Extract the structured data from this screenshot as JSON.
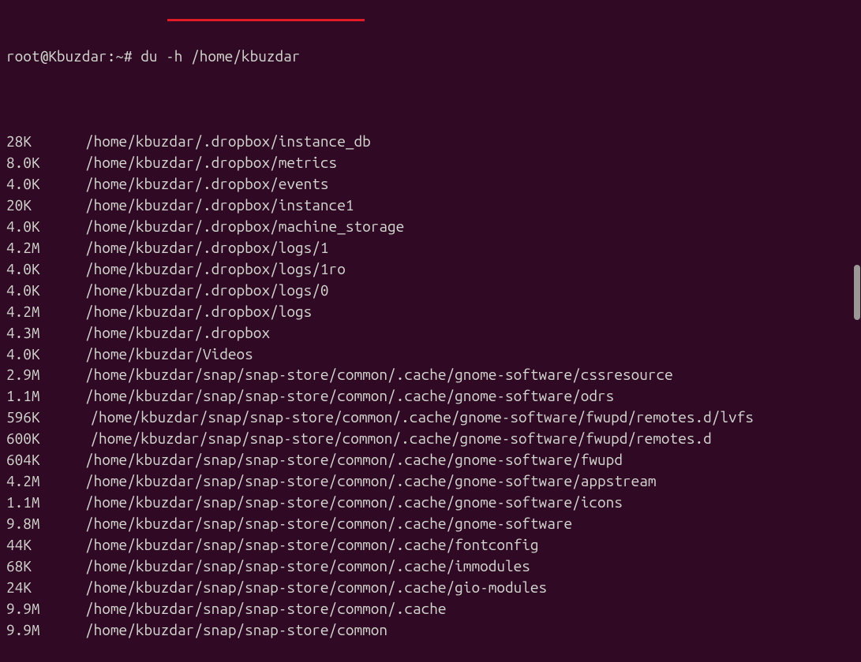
{
  "prompt": {
    "user": "root",
    "host": "Kbuzdar",
    "cwd": "~",
    "symbol": "#",
    "command": "du -h /home/kbuzdar"
  },
  "output": [
    {
      "size": "28K",
      "path": "/home/kbuzdar/.dropbox/instance_db"
    },
    {
      "size": "8.0K",
      "path": "/home/kbuzdar/.dropbox/metrics"
    },
    {
      "size": "4.0K",
      "path": "/home/kbuzdar/.dropbox/events"
    },
    {
      "size": "20K",
      "path": "/home/kbuzdar/.dropbox/instance1"
    },
    {
      "size": "4.0K",
      "path": "/home/kbuzdar/.dropbox/machine_storage"
    },
    {
      "size": "4.2M",
      "path": "/home/kbuzdar/.dropbox/logs/1"
    },
    {
      "size": "4.0K",
      "path": "/home/kbuzdar/.dropbox/logs/1ro"
    },
    {
      "size": "4.0K",
      "path": "/home/kbuzdar/.dropbox/logs/0"
    },
    {
      "size": "4.2M",
      "path": "/home/kbuzdar/.dropbox/logs"
    },
    {
      "size": "4.3M",
      "path": "/home/kbuzdar/.dropbox"
    },
    {
      "size": "4.0K",
      "path": "/home/kbuzdar/Videos"
    },
    {
      "size": "2.9M",
      "path": "/home/kbuzdar/snap/snap-store/common/.cache/gnome-software/cssresource"
    },
    {
      "size": "1.1M",
      "path": "/home/kbuzdar/snap/snap-store/common/.cache/gnome-software/odrs"
    },
    {
      "size": "596K",
      "path": "/home/kbuzdar/snap/snap-store/common/.cache/gnome-software/fwupd/remotes.d/lvfs",
      "wrap": true
    },
    {
      "size": "600K",
      "path": "/home/kbuzdar/snap/snap-store/common/.cache/gnome-software/fwupd/remotes.d",
      "wrap": true
    },
    {
      "size": "604K",
      "path": "/home/kbuzdar/snap/snap-store/common/.cache/gnome-software/fwupd"
    },
    {
      "size": "4.2M",
      "path": "/home/kbuzdar/snap/snap-store/common/.cache/gnome-software/appstream"
    },
    {
      "size": "1.1M",
      "path": "/home/kbuzdar/snap/snap-store/common/.cache/gnome-software/icons"
    },
    {
      "size": "9.8M",
      "path": "/home/kbuzdar/snap/snap-store/common/.cache/gnome-software"
    },
    {
      "size": "44K",
      "path": "/home/kbuzdar/snap/snap-store/common/.cache/fontconfig"
    },
    {
      "size": "68K",
      "path": "/home/kbuzdar/snap/snap-store/common/.cache/immodules"
    },
    {
      "size": "24K",
      "path": "/home/kbuzdar/snap/snap-store/common/.cache/gio-modules"
    },
    {
      "size": "9.9M",
      "path": "/home/kbuzdar/snap/snap-store/common/.cache"
    },
    {
      "size": "9.9M",
      "path": "/home/kbuzdar/snap/snap-store/common"
    }
  ]
}
